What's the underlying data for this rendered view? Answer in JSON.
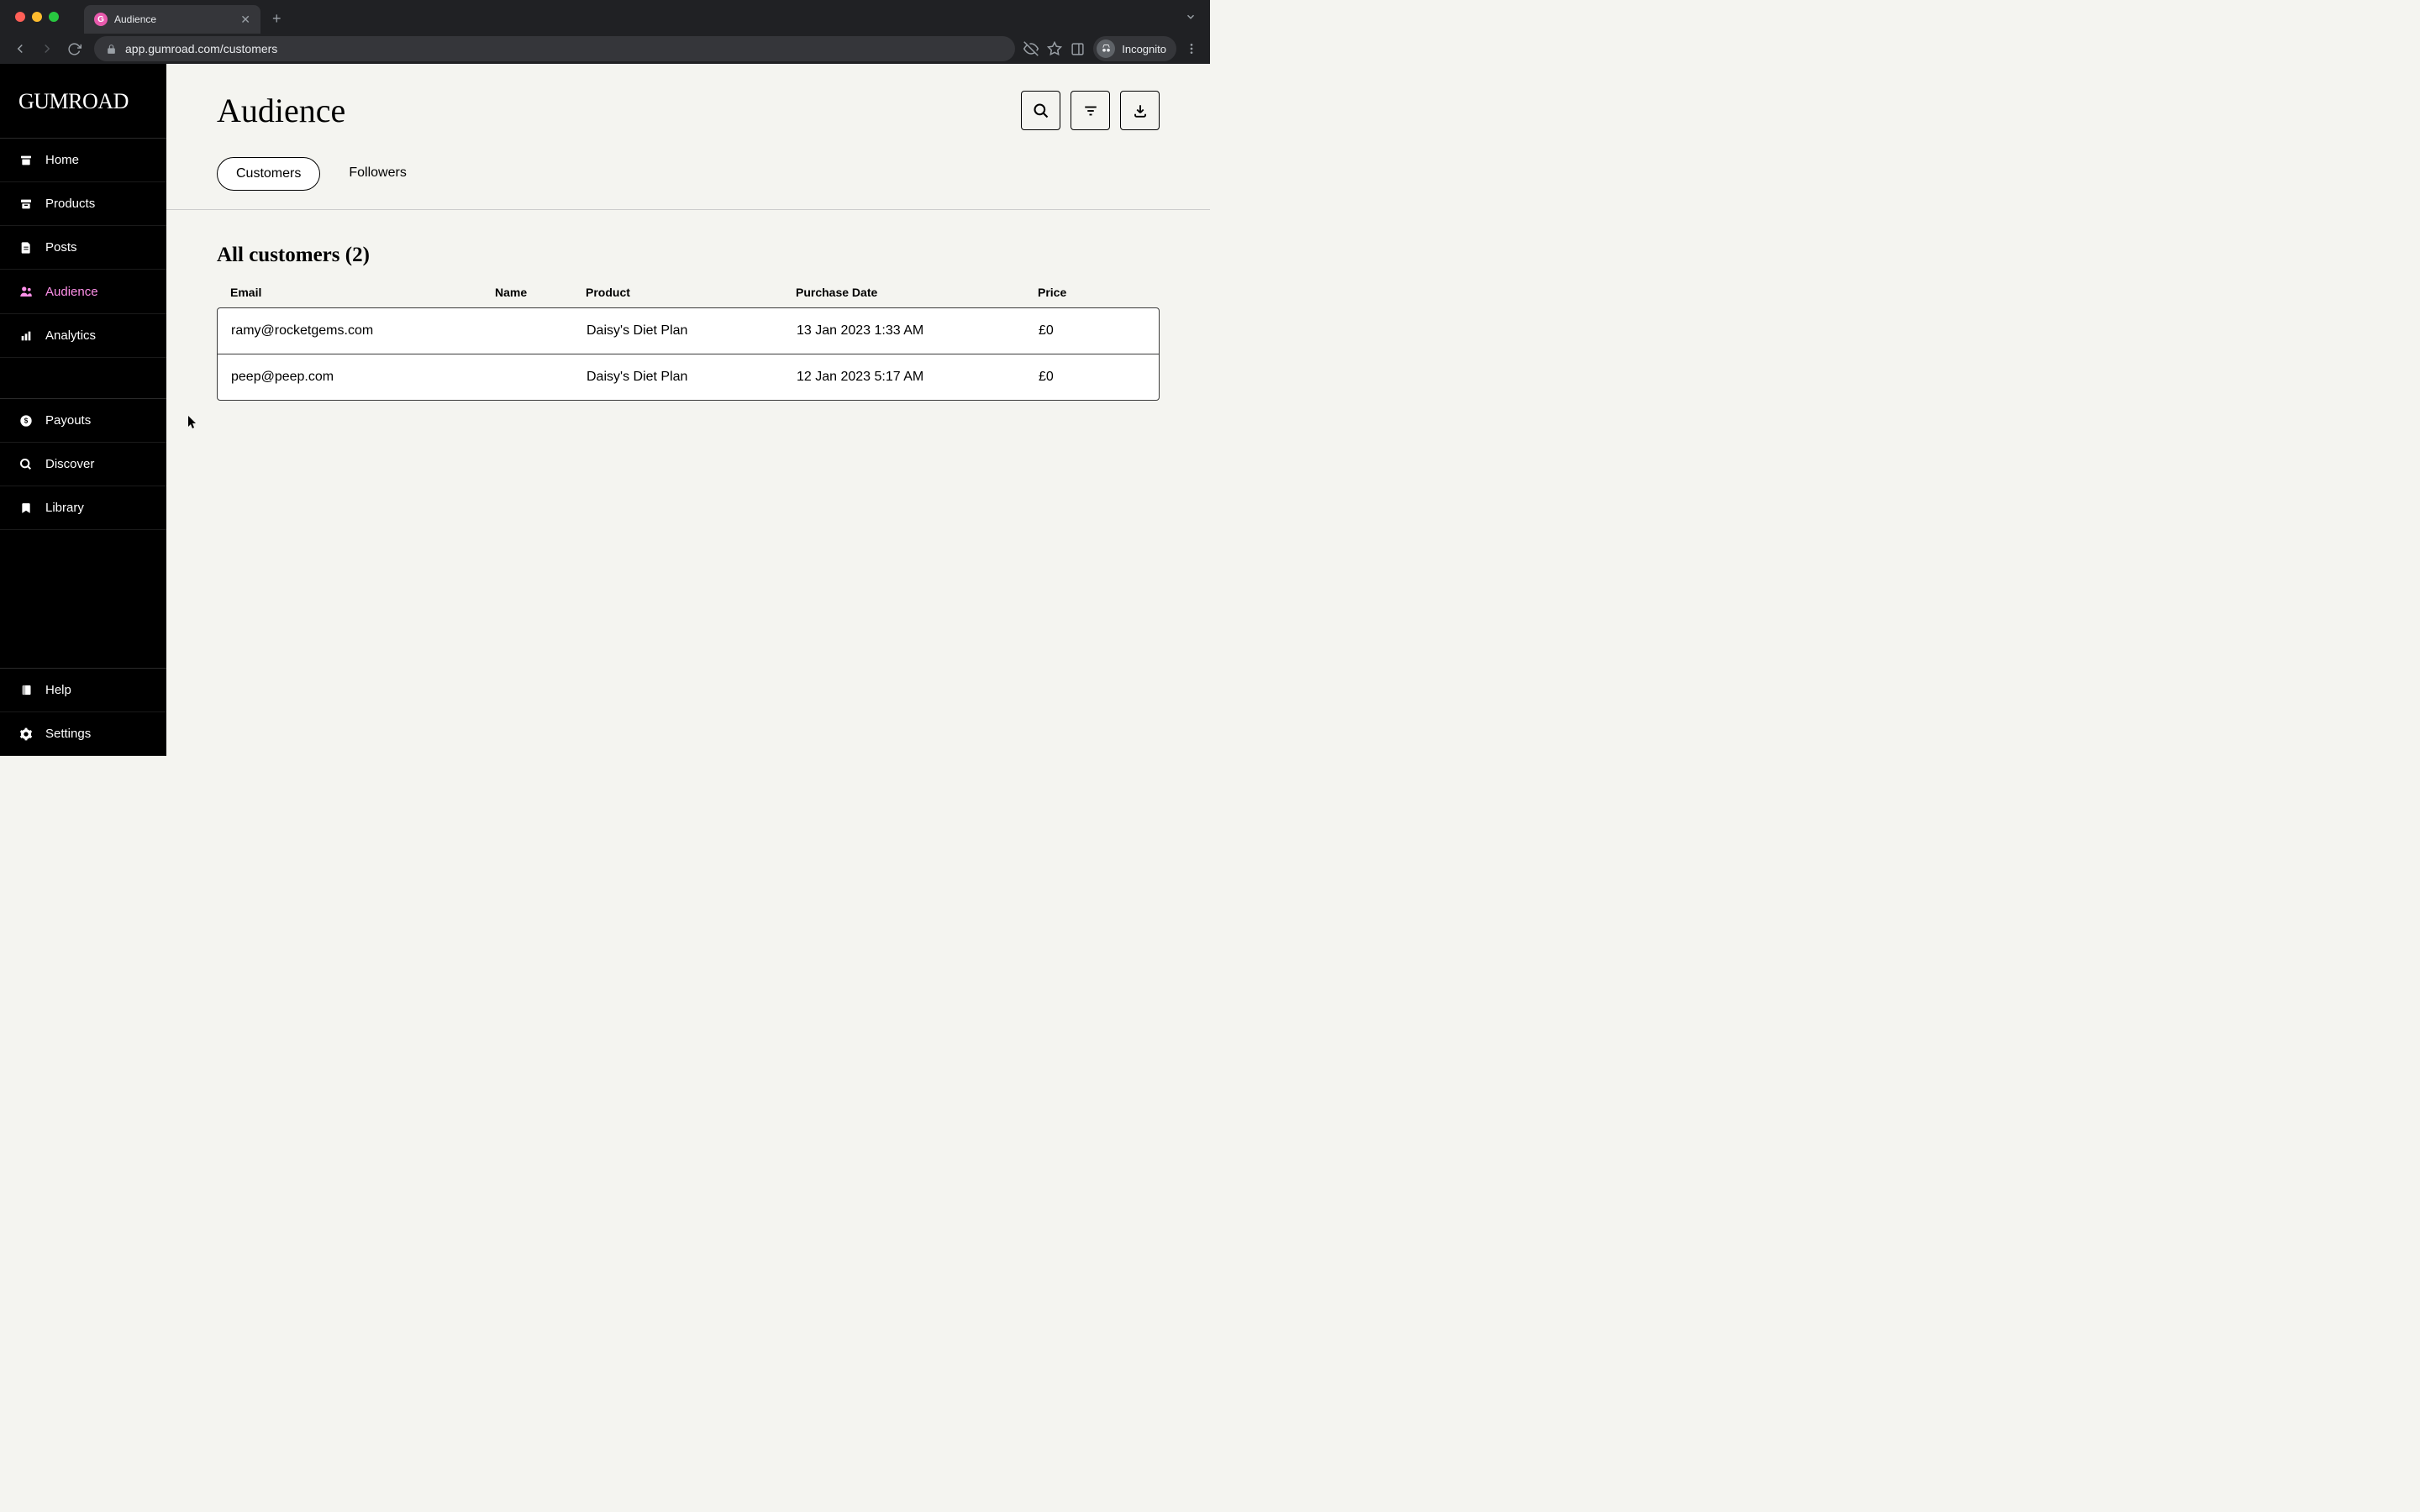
{
  "browser": {
    "tab_title": "Audience",
    "url": "app.gumroad.com/customers",
    "incognito_label": "Incognito"
  },
  "logo": "GUMROAD",
  "sidebar": {
    "items": [
      {
        "label": "Home",
        "icon": "home"
      },
      {
        "label": "Products",
        "icon": "archive"
      },
      {
        "label": "Posts",
        "icon": "file"
      },
      {
        "label": "Audience",
        "icon": "users",
        "active": true
      },
      {
        "label": "Analytics",
        "icon": "chart"
      }
    ],
    "items2": [
      {
        "label": "Payouts",
        "icon": "dollar"
      },
      {
        "label": "Discover",
        "icon": "search"
      },
      {
        "label": "Library",
        "icon": "bookmark"
      }
    ],
    "items3": [
      {
        "label": "Help",
        "icon": "book"
      },
      {
        "label": "Settings",
        "icon": "gear"
      }
    ]
  },
  "header": {
    "title": "Audience"
  },
  "tabs": [
    {
      "label": "Customers",
      "active": true
    },
    {
      "label": "Followers"
    }
  ],
  "section": {
    "title": "All customers (2)"
  },
  "table": {
    "columns": {
      "email": "Email",
      "name": "Name",
      "product": "Product",
      "date": "Purchase Date",
      "price": "Price"
    },
    "rows": [
      {
        "email": "ramy@rocketgems.com",
        "name": "",
        "product": "Daisy's Diet Plan",
        "date": "13 Jan 2023 1:33 AM",
        "price": "£0"
      },
      {
        "email": "peep@peep.com",
        "name": "",
        "product": "Daisy's Diet Plan",
        "date": "12 Jan 2023 5:17 AM",
        "price": "£0"
      }
    ]
  }
}
